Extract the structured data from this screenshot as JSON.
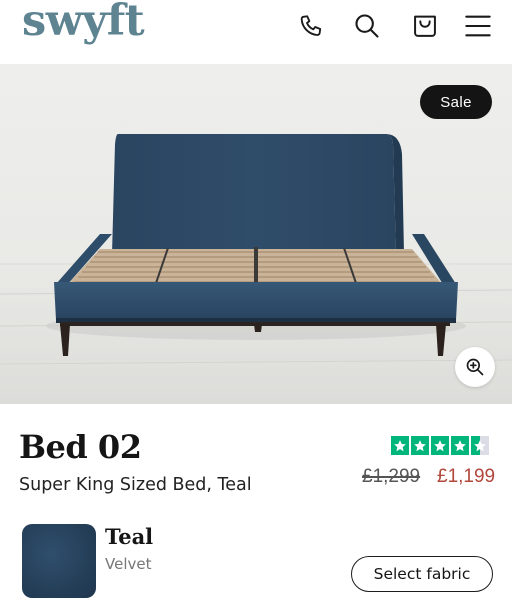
{
  "header": {
    "logo": "swyft",
    "icons": [
      "phone-icon",
      "search-icon",
      "basket-icon",
      "menu-icon"
    ]
  },
  "hero": {
    "badge": "Sale"
  },
  "product": {
    "title": "Bed 02",
    "subtitle": "Super King Sized Bed, Teal",
    "rating_stars": 4.5,
    "price_original": "£1,299",
    "price_sale": "£1,199"
  },
  "fabric": {
    "name": "Teal",
    "type": "Velvet",
    "select_label": "Select fabric"
  },
  "colors": {
    "brand": "#5e8391",
    "sale_price": "#b1473b",
    "trustpilot": "#00b67a",
    "badge_bg": "#141414",
    "velvet": "#274866"
  }
}
